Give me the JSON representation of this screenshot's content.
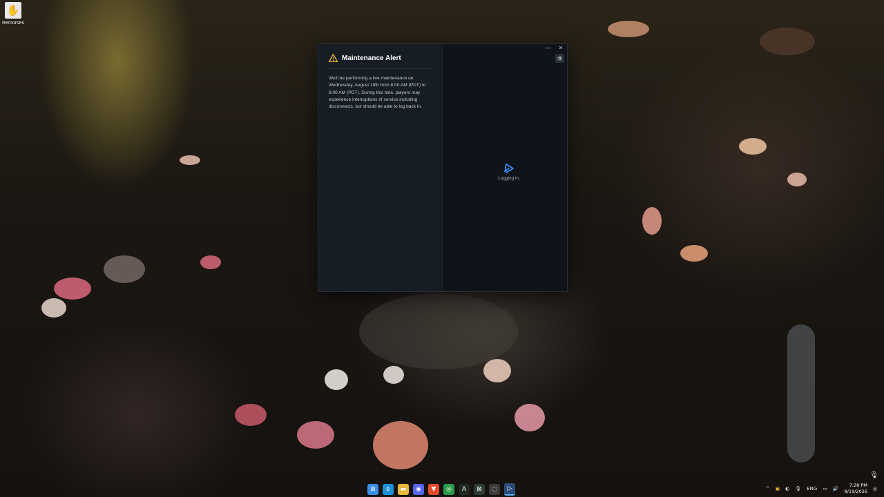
{
  "desktop": {
    "icons": [
      {
        "label": "Remorses",
        "icon": "game-shortcut-icon"
      }
    ]
  },
  "window": {
    "controls": {
      "minimize": "—",
      "close": "✕"
    },
    "alert": {
      "icon": "warning-icon",
      "title": "Maintenance Alert",
      "body": "We'll be performing a live maintenance on Wednesday, August 19th from 8:00 AM (PDT) to 9:00 AM (PDT). During this time, players may experience interruptions of service including disconnects, but should be able to log back in."
    },
    "status": {
      "icon": "launcher-logo-icon",
      "text": "Logging in."
    },
    "settings_icon": "gear-icon"
  },
  "taskbar": {
    "apps": [
      {
        "name": "start-button",
        "glyph": "⊞",
        "color": "#3a8fe6"
      },
      {
        "name": "edge-app",
        "glyph": "e",
        "color": "#1f8fd8"
      },
      {
        "name": "file-explorer-app",
        "glyph": "▬",
        "color": "#e8b93a"
      },
      {
        "name": "discord-app",
        "glyph": "◉",
        "color": "#5865f2"
      },
      {
        "name": "brave-app",
        "glyph": "▼",
        "color": "#e34a2a"
      },
      {
        "name": "chrome-app",
        "glyph": "◎",
        "color": "#2b9b4a"
      },
      {
        "name": "text-app",
        "glyph": "A",
        "color": "#1e2a22"
      },
      {
        "name": "xbox-app",
        "glyph": "⊠",
        "color": "#2c3a34"
      },
      {
        "name": "ring-app",
        "glyph": "◌",
        "color": "#3a3a3a"
      },
      {
        "name": "launcher-app",
        "glyph": "▷",
        "color": "#2a4a7a"
      }
    ],
    "tray": {
      "language": "ENG",
      "time": "7:28 PM",
      "date": "8/19/2026"
    }
  }
}
